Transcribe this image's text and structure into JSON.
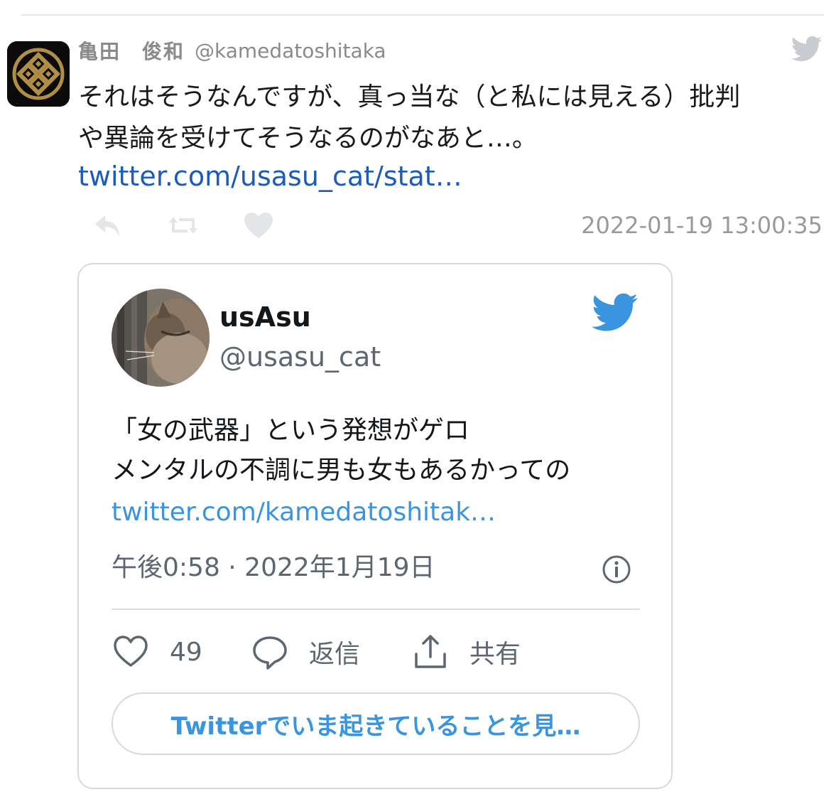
{
  "tweet": {
    "author_name": "亀田　俊和",
    "author_handle": "@kamedatoshitaka",
    "text_line1": "それはそうなんですが、真っ当な（と私には見える）批判",
    "text_line2": "や異論を受けてそうなるのがなあと…。",
    "link": "twitter.com/usasu_cat/stat…",
    "timestamp": "2022-01-19 13:00:35",
    "icons": [
      "reply-icon",
      "retweet-icon",
      "like-icon",
      "twitter-bird-icon"
    ]
  },
  "embed": {
    "name": "usAsu",
    "handle": "@usasu_cat",
    "text_line1": "「女の武器」という発想がゲロ",
    "text_line2": "メンタルの不調に男も女もあるかっての",
    "link": "twitter.com/kamedatoshitak…",
    "time": "午後0:58 · 2022年1月19日",
    "likes": "49",
    "reply_label": "返信",
    "share_label": "共有",
    "cta_label": "Twitterでいま起きていることを見…",
    "icons": [
      "heart-icon",
      "comment-icon",
      "share-icon",
      "info-icon",
      "twitter-bird-icon"
    ]
  },
  "colors": {
    "link_dark_blue": "#1c5bb8",
    "twitter_blue": "#3a94e0",
    "muted_grey": "#9a9a9a",
    "card_border": "#d5dae0",
    "crest_gold": "#b08f45"
  }
}
